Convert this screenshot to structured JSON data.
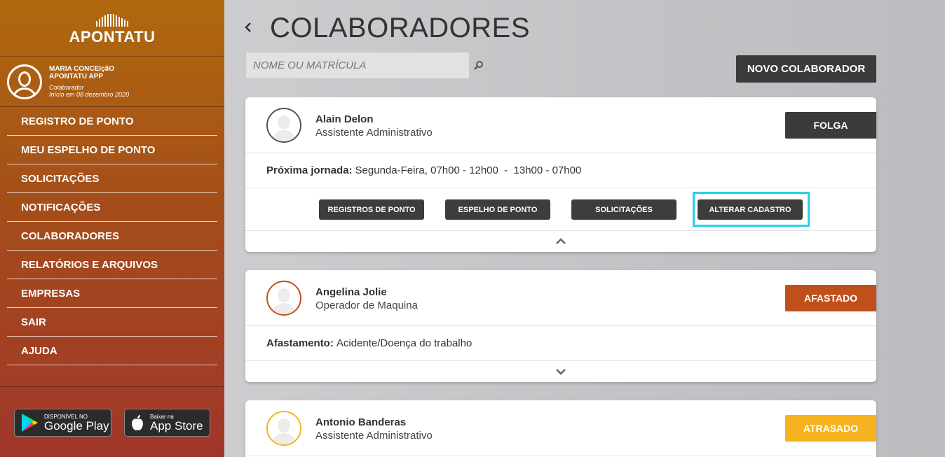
{
  "brand": {
    "logo_text": "APONTATU"
  },
  "user": {
    "name_line1": "MARIA CONCEIçãO",
    "name_line2": "APONTATU APP",
    "role": "Colaborador",
    "since": "Início em 08 dezembro 2020"
  },
  "menu": [
    {
      "label": "REGISTRO DE PONTO"
    },
    {
      "label": "MEU ESPELHO DE PONTO"
    },
    {
      "label": "SOLICITAÇÕES"
    },
    {
      "label": "NOTIFICAÇÕES"
    },
    {
      "label": "COLABORADORES"
    },
    {
      "label": "RELATÓRIOS E ARQUIVOS"
    },
    {
      "label": "EMPRESAS"
    },
    {
      "label": "SAIR"
    },
    {
      "label": "AJUDA"
    }
  ],
  "stores": {
    "google": {
      "small": "DISPONÍVEL NO",
      "big": "Google Play"
    },
    "apple": {
      "small": "Baixar na",
      "big": "App Store"
    }
  },
  "page": {
    "title": "COLABORADORES",
    "back_icon": "chevron-left-icon",
    "search_placeholder": "NOME OU MATRÍCULA",
    "new_button": "NOVO COLABORADOR"
  },
  "employees": [
    {
      "name": "Alain Delon",
      "role": "Assistente Administrativo",
      "status": "FOLGA",
      "status_color": "#3b3b3b",
      "avatar_border": "#555555",
      "info_label": "Próxima jornada:",
      "info_value": "Segunda-Feira, 07h00 - 12h00  -  13h00 - 07h00",
      "actions": [
        "REGISTROS DE PONTO",
        "ESPELHO DE PONTO",
        "SOLICITAÇÕES",
        "ALTERAR CADASTRO"
      ],
      "expanded": true
    },
    {
      "name": "Angelina Jolie",
      "role": "Operador de Maquina",
      "status": "AFASTADO",
      "status_color": "#c0501b",
      "avatar_border": "#c0501b",
      "info_label": "Afastamento:",
      "info_value": "Acidente/Doença do trabalho",
      "expanded": false
    },
    {
      "name": "Antonio Banderas",
      "role": "Assistente Administrativo",
      "status": "ATRASADO",
      "status_color": "#f5b41f",
      "avatar_border": "#f5b41f"
    }
  ]
}
